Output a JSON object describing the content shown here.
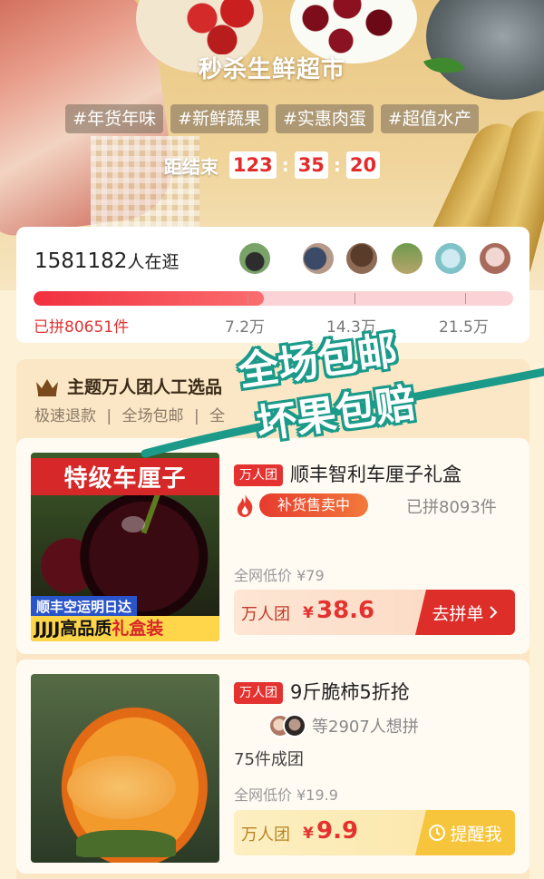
{
  "hero": {
    "title": "秒杀生鲜超市",
    "tags": [
      "#年货年味",
      "#新鲜蔬果",
      "#实惠肉蛋",
      "#超值水产"
    ],
    "countdown_label": "距结束",
    "countdown": {
      "hours": "123",
      "minutes": "35",
      "seconds": "20"
    }
  },
  "stats": {
    "count": "1581182",
    "count_suffix": "人在逛",
    "done_label": "已拼80651件",
    "milestones": [
      "7.2万",
      "14.3万",
      "21.5万"
    ],
    "progress": 0.48
  },
  "section": {
    "title": "主题万人团人工选品",
    "subtitle": [
      "极速退款",
      "|",
      "全场包邮",
      "|",
      "全"
    ],
    "promo_lines": [
      "全场包邮",
      "坏果包赔"
    ]
  },
  "products": [
    {
      "badge": "万人团",
      "name": "顺丰智利车厘子礼盒",
      "restock": "补货售卖中",
      "joined": "已拼8093件",
      "low_price": "全网低价 ¥79",
      "price_label": "万人团",
      "currency": "¥",
      "price": "38.6",
      "cta": "去拼单",
      "cta_icon": "chevron-right-icon",
      "thumb_top": "特级车厘子",
      "thumb_ship": "顺丰空运明日达",
      "thumb_quality_a": "JJJJ高品质",
      "thumb_quality_b": "礼盒装"
    },
    {
      "badge": "万人团",
      "name": "9斤脆柿5折抢",
      "group_text": "等2907人想拼",
      "formed": "75件成团",
      "low_price": "全网低价 ¥19.9",
      "price_label": "万人团",
      "currency": "¥",
      "price": "9.9",
      "cta": "提醒我",
      "cta_icon": "clock-icon"
    }
  ],
  "colors": {
    "accent": "#e3322f",
    "gold": "#f7c53c",
    "teal": "#1b9a8a"
  }
}
